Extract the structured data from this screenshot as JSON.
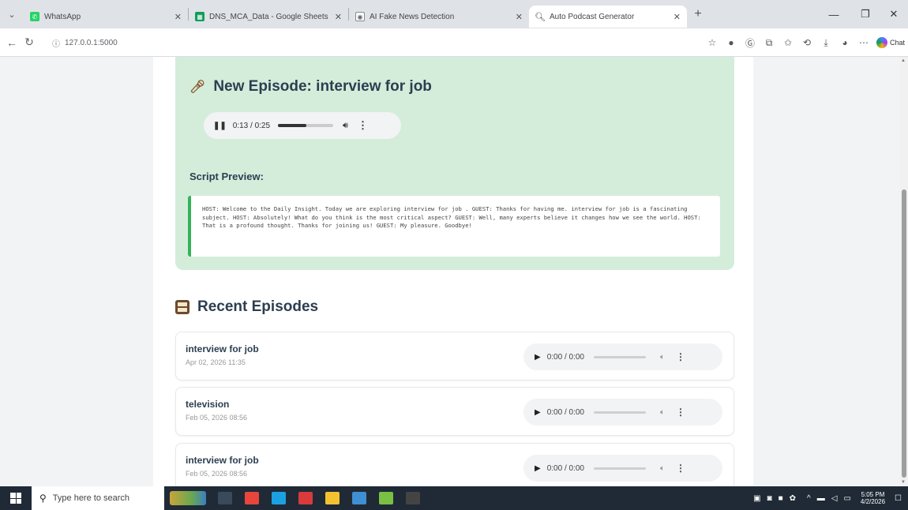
{
  "browser": {
    "tabs": [
      {
        "title": "WhatsApp",
        "icon": "whatsapp-icon",
        "color": "#25d366"
      },
      {
        "title": "DNS_MCA_Data - Google Sheets",
        "icon": "sheets-icon",
        "color": "#0f9d58"
      },
      {
        "title": "AI Fake News Detection",
        "icon": "globe-icon",
        "color": "#5f6368"
      },
      {
        "title": "Auto Podcast Generator",
        "icon": "magnifier-icon",
        "color": "#3c4043",
        "active": true
      }
    ],
    "url": "127.0.0.1:5000",
    "chat_label": "Chat"
  },
  "new_episode": {
    "title": "New Episode: interview for job",
    "player": {
      "current": "0:13",
      "duration": "0:25",
      "time_label": "0:13 / 0:25",
      "progress_fraction": 0.52
    },
    "script_label": "Script Preview:",
    "script_text": "HOST: Welcome to the Daily Insight. Today we are exploring interview for job . GUEST: Thanks for having me. interview for job  is a fascinating subject. HOST: Absolutely! What do you think is the most critical aspect? GUEST: Well, many experts believe it changes how we see the world. HOST: That is a profound thought. Thanks for joining us! GUEST: My pleasure. Goodbye!"
  },
  "recent": {
    "heading": "Recent Episodes",
    "episodes": [
      {
        "title": "interview for job",
        "date": "Apr 02, 2026 11:35",
        "time_label": "0:00 / 0:00"
      },
      {
        "title": "television",
        "date": "Feb 05, 2026 08:56",
        "time_label": "0:00 / 0:00"
      },
      {
        "title": "interview for job",
        "date": "Feb 05, 2026 08:56",
        "time_label": "0:00 / 0:00"
      }
    ]
  },
  "taskbar": {
    "search_placeholder": "Type here to search",
    "time": "5:05 PM",
    "date": "4/2/2026",
    "apps": [
      {
        "name": "task-view",
        "color": "#3b4a5a"
      },
      {
        "name": "chrome",
        "color": "#e8453c"
      },
      {
        "name": "edge",
        "color": "#1ba1e2"
      },
      {
        "name": "word-like",
        "color": "#d83b3b"
      },
      {
        "name": "folder",
        "color": "#f2c230"
      },
      {
        "name": "anaconda",
        "color": "#3f8fd2"
      },
      {
        "name": "notepad-green",
        "color": "#7ac143"
      },
      {
        "name": "terminal",
        "color": "#444"
      }
    ]
  }
}
